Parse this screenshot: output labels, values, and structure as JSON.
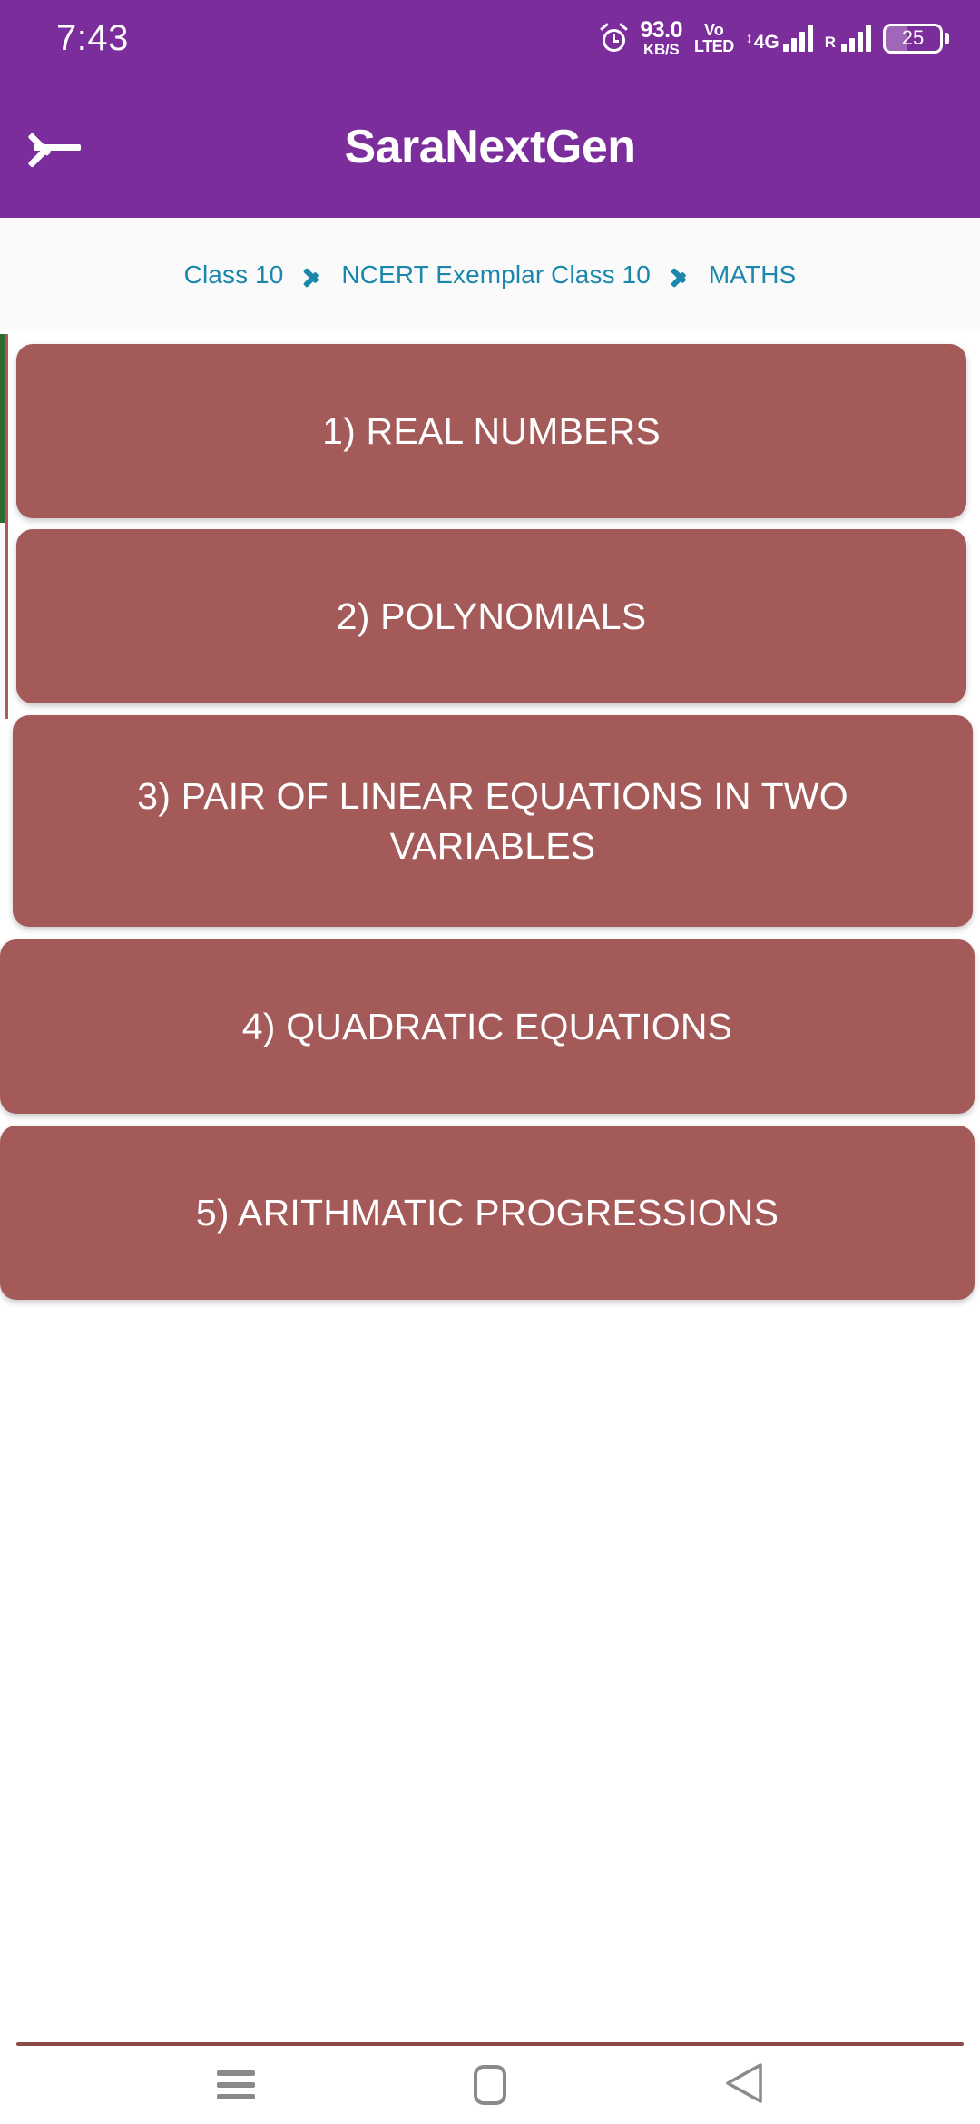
{
  "status_bar": {
    "clock": "7:43",
    "alarm_icon": "alarm-clock-icon",
    "net_speed_value": "93.0",
    "net_speed_unit": "KB/S",
    "volte_line1": "Vo",
    "volte_line2": "LTED",
    "updown_arrows": "↕",
    "network_gen": "4G",
    "roaming_label": "R",
    "battery_level": "25"
  },
  "app_bar": {
    "back_icon": "back-arrow-icon",
    "title": "SaraNextGen"
  },
  "breadcrumb": {
    "items": [
      {
        "label": "Class 10"
      },
      {
        "label": "NCERT Exemplar Class 10"
      },
      {
        "label": "MATHS"
      }
    ],
    "separator_icon": "chevron-right-icon",
    "color": "#1C87AC"
  },
  "chapters": {
    "card_color": "#A55A5A",
    "text_color": "#FFFFFF",
    "items": [
      {
        "label": "1) REAL NUMBERS"
      },
      {
        "label": "2) POLYNOMIALS"
      },
      {
        "label": "3) PAIR OF LINEAR EQUATIONS IN TWO VARIABLES"
      },
      {
        "label": "4) QUADRATIC EQUATIONS"
      },
      {
        "label": "5) ARITHMATIC PROGRESSIONS"
      }
    ]
  },
  "nav_bar": {
    "recents_icon": "recents-menu-icon",
    "home_icon": "home-icon",
    "back_icon": "back-triangle-icon"
  },
  "theme": {
    "app_bar_color": "#7B2D9B",
    "breadcrumb_bg": "#FAFAFA",
    "divider_color": "#8D4A4A"
  }
}
